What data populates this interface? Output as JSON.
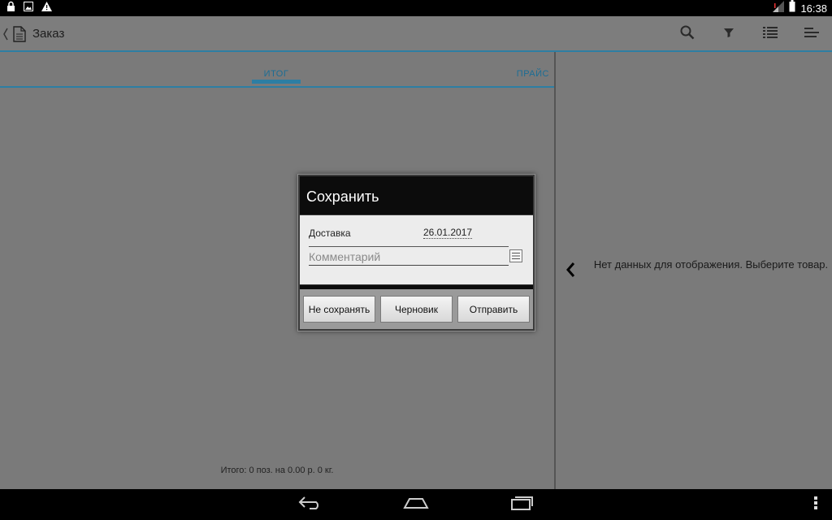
{
  "status_bar": {
    "time": "16:38",
    "left_icons": [
      "lock-icon",
      "image-icon",
      "warning-icon"
    ],
    "right_icons": [
      "signal-icon",
      "battery-icon"
    ]
  },
  "action_bar": {
    "title": "Заказ",
    "actions": [
      "search-icon",
      "filter-icon",
      "list-icon",
      "sort-icon"
    ]
  },
  "tabs": [
    {
      "label": "ИТОГ",
      "selected": true
    },
    {
      "label": "ПРАЙС",
      "selected": false
    }
  ],
  "footer": {
    "total": "Итого: 0 поз. на 0.00 р. 0 кг."
  },
  "right_pane": {
    "message": "Нет данных для отображения. Выберите товар."
  },
  "dialog": {
    "title": "Сохранить",
    "delivery_label": "Доставка",
    "delivery_date": "26.01.2017",
    "comment_placeholder": "Комментарий",
    "comment_value": "",
    "buttons": {
      "dont_save": "Не сохранять",
      "draft": "Черновик",
      "send": "Отправить"
    }
  },
  "colors": {
    "accent": "#2d7ea3",
    "overlay": "#7a7a7a",
    "dialog_title_bg": "#0c0c0c"
  }
}
